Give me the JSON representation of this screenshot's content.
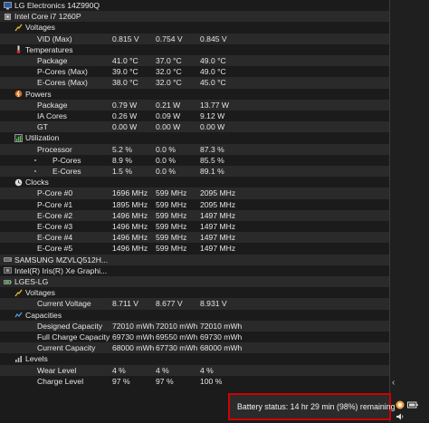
{
  "tree": [
    {
      "label": "LG Electronics 14Z990Q",
      "icon": "monitor-icon",
      "level": 0
    },
    {
      "label": "Intel Core i7 1260P",
      "icon": "cpu-icon",
      "level": 0
    },
    {
      "label": "Voltages",
      "icon": "voltage-icon",
      "level": 1
    },
    {
      "label": "VID (Max)",
      "level": 2,
      "v1": "0.815 V",
      "v2": "0.754 V",
      "v3": "0.845 V"
    },
    {
      "label": "Temperatures",
      "icon": "thermometer-icon",
      "level": 1
    },
    {
      "label": "Package",
      "level": 2,
      "v1": "41.0 °C",
      "v2": "37.0 °C",
      "v3": "49.0 °C"
    },
    {
      "label": "P-Cores (Max)",
      "level": 2,
      "v1": "39.0 °C",
      "v2": "32.0 °C",
      "v3": "49.0 °C"
    },
    {
      "label": "E-Cores (Max)",
      "level": 2,
      "v1": "38.0 °C",
      "v2": "32.0 °C",
      "v3": "45.0 °C"
    },
    {
      "label": "Powers",
      "icon": "power-icon",
      "level": 1
    },
    {
      "label": "Package",
      "level": 2,
      "v1": "0.79 W",
      "v2": "0.21 W",
      "v3": "13.77 W"
    },
    {
      "label": "IA Cores",
      "level": 2,
      "v1": "0.26 W",
      "v2": "0.09 W",
      "v3": "9.12 W"
    },
    {
      "label": "GT",
      "level": 2,
      "v1": "0.00 W",
      "v2": "0.00 W",
      "v3": "0.00 W"
    },
    {
      "label": "Utilization",
      "icon": "utilization-icon",
      "level": 1
    },
    {
      "label": "Processor",
      "level": 2,
      "v1": "5.2 %",
      "v2": "0.0 %",
      "v3": "87.3 %"
    },
    {
      "label": "P-Cores",
      "level": 3,
      "v1": "8.9 %",
      "v2": "0.0 %",
      "v3": "85.5 %"
    },
    {
      "label": "E-Cores",
      "level": 3,
      "v1": "1.5 %",
      "v2": "0.0 %",
      "v3": "89.1 %"
    },
    {
      "label": "Clocks",
      "icon": "clock-icon",
      "level": 1
    },
    {
      "label": "P-Core #0",
      "level": 2,
      "v1": "1696 MHz",
      "v2": "599 MHz",
      "v3": "2095 MHz"
    },
    {
      "label": "P-Core #1",
      "level": 2,
      "v1": "1895 MHz",
      "v2": "599 MHz",
      "v3": "2095 MHz"
    },
    {
      "label": "E-Core #2",
      "level": 2,
      "v1": "1496 MHz",
      "v2": "599 MHz",
      "v3": "1497 MHz"
    },
    {
      "label": "E-Core #3",
      "level": 2,
      "v1": "1496 MHz",
      "v2": "599 MHz",
      "v3": "1497 MHz"
    },
    {
      "label": "E-Core #4",
      "level": 2,
      "v1": "1496 MHz",
      "v2": "599 MHz",
      "v3": "1497 MHz"
    },
    {
      "label": "E-Core #5",
      "level": 2,
      "v1": "1496 MHz",
      "v2": "599 MHz",
      "v3": "1497 MHz"
    },
    {
      "label": "SAMSUNG MZVLQ512H...",
      "icon": "drive-icon",
      "level": 0
    },
    {
      "label": "Intel(R) Iris(R) Xe Graphi...",
      "icon": "gpu-icon",
      "level": 0
    },
    {
      "label": "LGES-LG",
      "icon": "battery-icon",
      "level": 0
    },
    {
      "label": "Voltages",
      "icon": "voltage-icon",
      "level": 1
    },
    {
      "label": "Current Voltage",
      "level": 2,
      "v1": "8.711 V",
      "v2": "8.677 V",
      "v3": "8.931 V"
    },
    {
      "label": "Capacities",
      "icon": "capacity-icon",
      "level": 1
    },
    {
      "label": "Designed Capacity",
      "level": 2,
      "v1": "72010 mWh",
      "v2": "72010 mWh",
      "v3": "72010 mWh"
    },
    {
      "label": "Full Charge Capacity",
      "level": 2,
      "v1": "69730 mWh",
      "v2": "69550 mWh",
      "v3": "69730 mWh"
    },
    {
      "label": "Current Capacity",
      "level": 2,
      "v1": "68000 mWh",
      "v2": "67730 mWh",
      "v3": "68000 mWh"
    },
    {
      "label": "Levels",
      "icon": "levels-icon",
      "level": 1
    },
    {
      "label": "Wear Level",
      "level": 2,
      "v1": "4 %",
      "v2": "4 %",
      "v3": "4 %"
    },
    {
      "label": "Charge Level",
      "level": 2,
      "v1": "97 %",
      "v2": "97 %",
      "v3": "100 %"
    }
  ],
  "toast": {
    "text": "Battery status: 14 hr 29 min (98%) remaining"
  },
  "tray": {
    "icons": [
      "color-picker-icon",
      "battery-icon",
      "volume-icon"
    ],
    "chevron": "chevron-left-icon"
  },
  "colors": {
    "background": "#1b1b1b",
    "alt_row": "#2a2a2a",
    "toast_border": "#d00000"
  }
}
